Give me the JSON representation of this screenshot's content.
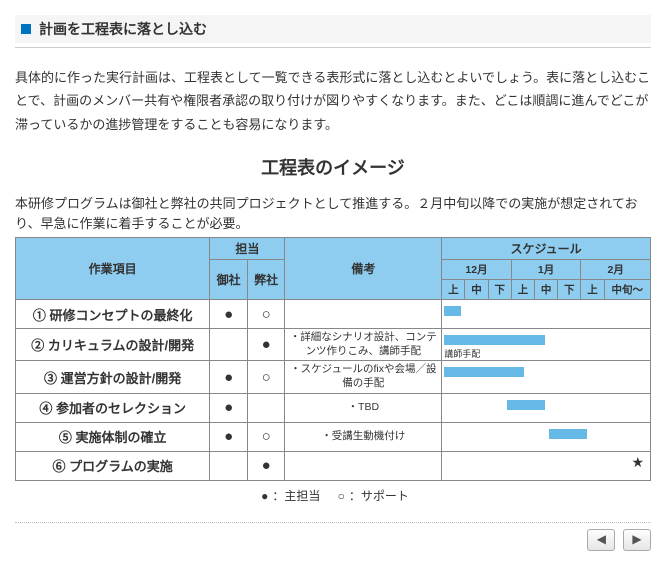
{
  "section_title": "計画を工程表に落とし込む",
  "body_text": "具体的に作った実行計画は、工程表として一覧できる表形式に落とし込むとよいでしょう。表に落とし込むことで、計画のメンバー共有や権限者承認の取り付けが図りやすくなります。また、どこは順調に進んでどこが滞っているかの進捗管理をすることも容易になります。",
  "chart_title": "工程表のイメージ",
  "chart_note": "本研修プログラムは御社と弊社の共同プロジェクトとして推進する。２月中旬以降での実施が想定されており、早急に作業に着手することが必要。",
  "headers": {
    "task": "作業項目",
    "role": "担当",
    "role_a": "御社",
    "role_b": "弊社",
    "note": "備考",
    "schedule": "スケジュール",
    "months": [
      "12月",
      "1月",
      "2月"
    ],
    "subs": [
      "上",
      "中",
      "下",
      "上",
      "中",
      "下",
      "上",
      "中旬～"
    ]
  },
  "rows": [
    {
      "idx": "①",
      "task": "研修コンセプトの最終化",
      "a": "●",
      "b": "○",
      "note": ""
    },
    {
      "idx": "②",
      "task": "カリキュラムの設計/開発",
      "a": "",
      "b": "●",
      "note": "・詳細なシナリオ設計、コンテンツ作りこみ、講師手配",
      "tag": "講師手配"
    },
    {
      "idx": "③",
      "task": "運営方針の設計/開発",
      "a": "●",
      "b": "○",
      "note": "・スケジュールのfixや会場／設備の手配"
    },
    {
      "idx": "④",
      "task": "参加者のセレクション",
      "a": "●",
      "b": "",
      "note": "・TBD"
    },
    {
      "idx": "⑤",
      "task": "実施体制の確立",
      "a": "●",
      "b": "○",
      "note": "・受講生動機付け"
    },
    {
      "idx": "⑥",
      "task": "プログラムの実施",
      "a": "",
      "b": "●",
      "note": "",
      "star": "★"
    }
  ],
  "legend": {
    "lead_sym": "●",
    "lead_label": "：主担当",
    "support_sym": "○",
    "support_label": "：サポート"
  },
  "nav": {
    "prev": "◀",
    "next": "▶"
  },
  "chart_data": {
    "type": "bar",
    "title": "工程表のイメージ",
    "x_units": [
      "12月上",
      "12月中",
      "12月下",
      "1月上",
      "1月中",
      "1月下",
      "2月上",
      "2月中旬～"
    ],
    "series": [
      {
        "name": "研修コンセプトの最終化",
        "start": 0,
        "end": 1
      },
      {
        "name": "カリキュラムの設計/開発",
        "start": 0,
        "end": 5,
        "label": "講師手配"
      },
      {
        "name": "運営方針の設計/開発",
        "start": 0,
        "end": 4
      },
      {
        "name": "参加者のセレクション",
        "start": 3,
        "end": 5
      },
      {
        "name": "実施体制の確立",
        "start": 5,
        "end": 7
      },
      {
        "name": "プログラムの実施",
        "start": 7,
        "end": 8,
        "milestone": true
      }
    ]
  }
}
